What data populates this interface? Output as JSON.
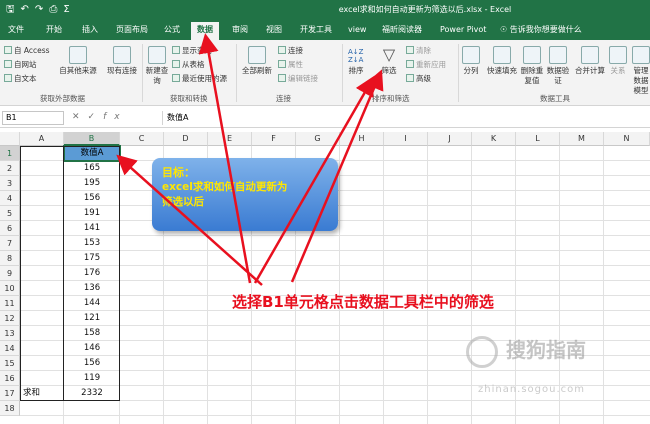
{
  "window": {
    "title": "excel求和如何自动更新为筛选以后.xlsx - Excel"
  },
  "qat": {
    "save_icon": "save-icon",
    "undo_icon": "undo-icon",
    "redo_icon": "redo-icon"
  },
  "tabs": [
    "文件",
    "开始",
    "插入",
    "页面布局",
    "公式",
    "数据",
    "审阅",
    "视图",
    "开发工具",
    "view",
    "福昕阅读器",
    "Power Pivot"
  ],
  "active_tab": "数据",
  "tell_me": "告诉我你想要做什么",
  "ribbon": {
    "get_external": {
      "items": [
        "自 Access",
        "自网站",
        "自文本"
      ],
      "other_sources": "自其他来源",
      "existing": "现有连接",
      "label": "获取外部数据"
    },
    "get_transform": {
      "new_query": "新建查询",
      "items": [
        "显示查询",
        "从表格",
        "最近使用的源"
      ],
      "label": "获取和转换"
    },
    "connections": {
      "refresh_all": "全部刷新",
      "items": [
        "连接",
        "属性",
        "编辑链接"
      ],
      "label": "连接"
    },
    "sort_filter": {
      "sort": "排序",
      "filter": "筛选",
      "items": [
        "清除",
        "重新应用",
        "高级"
      ],
      "label": "排序和筛选"
    },
    "data_tools": {
      "items": [
        "分列",
        "快速填充",
        "删除重复值",
        "数据验证",
        "合并计算",
        "关系",
        "管理数据模型"
      ],
      "label": "数据工具"
    }
  },
  "formula_bar": {
    "name_box": "B1",
    "value": "数值A"
  },
  "columns": [
    "A",
    "B",
    "C",
    "D",
    "E",
    "F",
    "G",
    "H",
    "I",
    "J",
    "K",
    "L",
    "M",
    "N"
  ],
  "rows": [
    "1",
    "2",
    "3",
    "4",
    "5",
    "6",
    "7",
    "8",
    "9",
    "10",
    "11",
    "12",
    "13",
    "14",
    "15",
    "16",
    "17",
    "18"
  ],
  "cells": {
    "b1": "数值A",
    "values": [
      "165",
      "195",
      "156",
      "191",
      "141",
      "153",
      "175",
      "176",
      "136",
      "144",
      "121",
      "158",
      "146",
      "156",
      "119"
    ],
    "sum_label": "求和",
    "sum_value": "2332"
  },
  "callout": {
    "heading": "目标：",
    "line1": "excel求和如何自动更新为",
    "line2": "筛选以后"
  },
  "instruction": "选择B1单元格点击数据工具栏中的筛选",
  "watermark": {
    "text": "搜狗指南",
    "url": "zhinan.sogou.com"
  },
  "colors": {
    "excel_green": "#217346",
    "header_fill": "#5b9bd5",
    "annotation_red": "#e8101f",
    "callout_text": "#ffe600"
  }
}
